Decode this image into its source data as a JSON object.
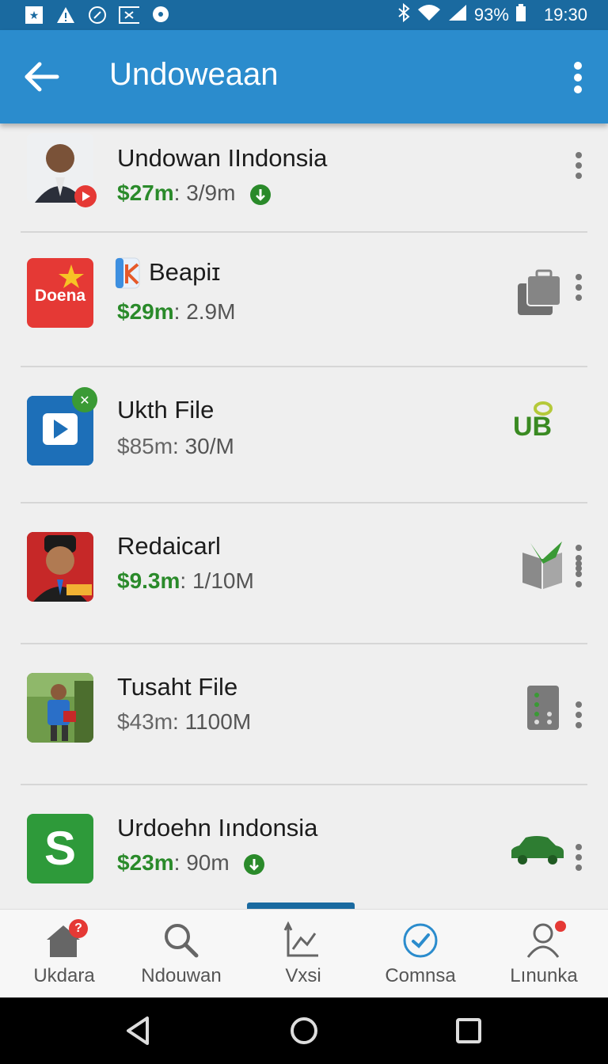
{
  "status_bar": {
    "battery": "93%",
    "time": "19:30",
    "icons": [
      "star-notification-icon",
      "warning-icon",
      "compass-icon",
      "image-icon",
      "chat-bubble-icon",
      "bluetooth-icon",
      "wifi-icon",
      "signal-icon",
      "battery-icon"
    ]
  },
  "app_bar": {
    "title": "Undoweaan"
  },
  "items": [
    {
      "name": "Undowan IIndonsia",
      "price": "$27m",
      "sep": ": ",
      "size": "3/9m",
      "price_color": "green"
    },
    {
      "name": "Beapiɪ",
      "price": "$29m",
      "sep": ": ",
      "size": "2.9M",
      "price_color": "green"
    },
    {
      "name": "Ukth File",
      "price": "$85m",
      "sep": ": ",
      "size": "30/M",
      "price_color": "gray"
    },
    {
      "name": "Redaicarl",
      "price": "$9.3m",
      "sep": ": ",
      "size": "1/10M",
      "price_color": "green"
    },
    {
      "name": "Tusaht File",
      "price": "$43m",
      "sep": ": ",
      "size": "1100M",
      "price_color": "gray"
    },
    {
      "name": "Urdoehn Iındonsia",
      "price": "$23m",
      "sep": ": ",
      "size": "90m",
      "price_color": "green"
    }
  ],
  "thumb_labels": {
    "doena": "Doena",
    "s_logo": "S"
  },
  "side_labels": {
    "ub": "UB"
  },
  "bottom_nav": [
    {
      "label": "Ukdara",
      "badge": "?"
    },
    {
      "label": "Ndouwan"
    },
    {
      "label": "Vxsi"
    },
    {
      "label": "Comnsa"
    },
    {
      "label": "Lınunka"
    }
  ],
  "colors": {
    "app_bar": "#2b8ccd",
    "status_bar": "#1a6aa0",
    "price_green": "#2a8a2a",
    "badge_red": "#e53935"
  }
}
